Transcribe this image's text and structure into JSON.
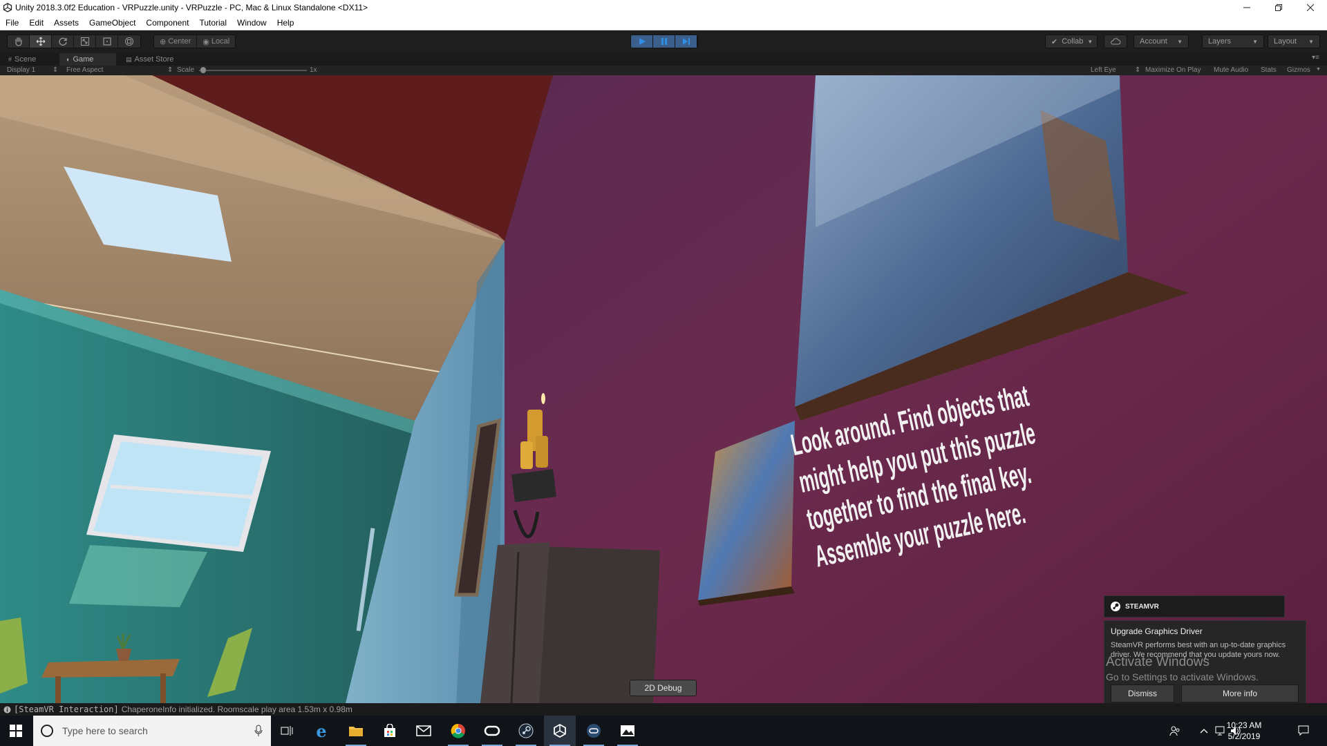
{
  "window": {
    "title": "Unity 2018.3.0f2 Education - VRPuzzle.unity - VRPuzzle - PC, Mac & Linux Standalone <DX11>"
  },
  "menu": {
    "items": [
      {
        "label": "File"
      },
      {
        "label": "Edit"
      },
      {
        "label": "Assets"
      },
      {
        "label": "GameObject"
      },
      {
        "label": "Component"
      },
      {
        "label": "Tutorial"
      },
      {
        "label": "Window"
      },
      {
        "label": "Help"
      }
    ]
  },
  "toolbar": {
    "tools": [
      {
        "name": "hand-tool",
        "icon": "hand-icon"
      },
      {
        "name": "move-tool",
        "icon": "move-icon",
        "active": true
      },
      {
        "name": "rotate-tool",
        "icon": "rotate-icon"
      },
      {
        "name": "scale-tool",
        "icon": "scale-icon"
      },
      {
        "name": "rect-tool",
        "icon": "rect-icon"
      },
      {
        "name": "transform-tool",
        "icon": "transform-icon"
      }
    ],
    "pivot_label": "Center",
    "space_label": "Local",
    "collab_label": "Collab",
    "account_label": "Account",
    "layers_label": "Layers",
    "layout_label": "Layout",
    "play_state": "playing"
  },
  "tabs": {
    "scene": "Scene",
    "game": "Game",
    "asset_store": "Asset Store"
  },
  "game_view": {
    "display": "Display 1",
    "aspect": "Free Aspect",
    "scale_label": "Scale",
    "scale_value": "1x",
    "eye": "Left Eye",
    "maximize_on_play": "Maximize On Play",
    "mute_audio": "Mute Audio",
    "stats": "Stats",
    "gizmos": "Gizmos"
  },
  "scene": {
    "wall_text": [
      "Look around. Find objects that",
      "might help you put this puzzle",
      "together to find the final key.",
      "Assemble your puzzle here."
    ],
    "debug_button": "2D Debug"
  },
  "steamvr_notification": {
    "brand": "STEAMVR",
    "title": "Upgrade Graphics Driver",
    "message": "SteamVR performs best with an up-to-date graphics driver. We recommend that you update yours now.",
    "dismiss_label": "Dismiss",
    "more_info_label": "More info"
  },
  "watermark": {
    "line1": "Activate Windows",
    "line2": "Go to Settings to activate Windows."
  },
  "status": {
    "tag": "[SteamVR Interaction]",
    "message": "ChaperoneInfo initialized. Roomscale play area 1.53m x 0.98m"
  },
  "taskbar": {
    "search_placeholder": "Type here to search",
    "time": "10:23 AM",
    "date": "5/2/2019"
  },
  "colors": {
    "wall_purple": "#6b2a4d",
    "teal_wall": "#2f7c78",
    "unity_dark": "#1e1e1e",
    "play_blue": "#3b5e8a"
  }
}
